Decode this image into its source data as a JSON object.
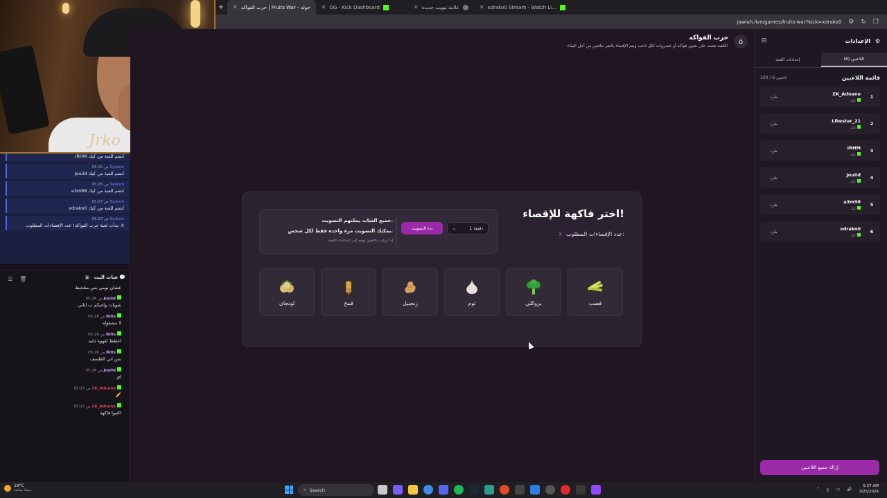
{
  "browser": {
    "tabs": [
      {
        "label": "حرب الفواكه | Fruits War - جوله",
        "active": true
      },
      {
        "label": "OG - Kick Dashboard",
        "active": false
      },
      {
        "label": "علامة تبويب جديدة",
        "active": false
      },
      {
        "label": "xdrako0 Stream - Watch Li...",
        "active": false
      }
    ],
    "url": "jawlah.live/games/fruits-war?kick=xdrako0"
  },
  "webcam": {
    "signature": "Jrko"
  },
  "system_messages": [
    {
      "user": "",
      "time": "",
      "text": "IRHM انضم للعبة من كيك"
    },
    {
      "user": "System",
      "time": "05:25 ص",
      "text": "Jouiid انضم للعبة من كيك"
    },
    {
      "user": "System",
      "time": "05:25 ص",
      "text": "a3m98 انضم للعبة من كيك"
    },
    {
      "user": "System",
      "time": "05:27 ص",
      "text": "xdrako0 انضم للعبة من كيك"
    },
    {
      "user": "System",
      "time": "05:27 ص",
      "text": "بدأت لعبة حرب الفواكه! عدد الإقصاءات المطلوب: X"
    }
  ],
  "chat": {
    "title": "شات البث",
    "first_message": "عشان تومي بس متلخبط",
    "messages": [
      {
        "user": "Jouiid",
        "time": "05:26 ص",
        "text": "شويات واجيكم ب ايابي"
      },
      {
        "user": "Bilts",
        "time": "05:26 ص",
        "text": "لا مشفوله"
      },
      {
        "user": "Bilts",
        "time": "05:26 ص",
        "text": "اخطط لقهوة ثانيه"
      },
      {
        "user": "Bilts",
        "time": "05:26 ص",
        "text": "بس اني الفلسف"
      },
      {
        "user": "Jouiid",
        "time": "05:26 ص",
        "text": "اي"
      },
      {
        "user": "ZK_Adnane",
        "time": "05:27 ص",
        "text": "🥖"
      },
      {
        "user": "ZK_Adnane",
        "time": "05:27 ص",
        "text": "اكتبوا فاكهة"
      }
    ]
  },
  "game": {
    "title": "حرب الفواكه",
    "description": "اللعبة تعتمد على تعيين فواكه أو خضروات لكل لاعب ويتم الإقصاء بالتفر تنافس من أجل البقاء!",
    "card_title": "اختر فاكهة للإقصاء!",
    "eliminations_label": "عدد الإقصاءات المطلوب:",
    "eliminations_value": "X",
    "vote_line1": "جميع الشات يمكنهم التصويت.",
    "vote_line2": "يمكنك التصويت مرة واحدة فقط لكل شخص.",
    "vote_hint": "إذا ترغب بالتغيير توجه إلى إعدادات اللعبة",
    "start_vote_label": "بدء التصويت",
    "duration_label": "1 دقيقة",
    "fruits": [
      {
        "label": "قصب",
        "icon": "sugarcane-icon",
        "color": "#c8d84a"
      },
      {
        "label": "بروكلي",
        "icon": "broccoli-icon",
        "color": "#3fae3a"
      },
      {
        "label": "ثوم",
        "icon": "garlic-icon",
        "color": "#e9e3dc"
      },
      {
        "label": "زنجبيل",
        "icon": "ginger-icon",
        "color": "#d6a25a"
      },
      {
        "label": "قمح",
        "icon": "wheat-icon",
        "color": "#d9a441"
      },
      {
        "label": "لونجان",
        "icon": "longan-icon",
        "color": "#d8c17a"
      }
    ]
  },
  "panel": {
    "title": "الإعدادات",
    "tab_players": "اللاعبين (6)",
    "tab_settings": "إعدادات اللعبة",
    "list_title": "قائمة اللاعبين",
    "count": "100 / 6 لاعبين",
    "kick_label": "طرد",
    "platform": "كيك",
    "players": [
      {
        "num": "1",
        "name": "ZK_Adnane"
      },
      {
        "num": "2",
        "name": "Likestar_21"
      },
      {
        "num": "3",
        "name": "IRHM"
      },
      {
        "num": "4",
        "name": "Jouiid"
      },
      {
        "num": "5",
        "name": "a3m98"
      },
      {
        "num": "6",
        "name": "xdrako0"
      }
    ],
    "remove_all_label": "إزالة جميع اللاعبين"
  },
  "taskbar": {
    "weather_temp": "19°C",
    "weather_desc": "سماء صافية",
    "search_label": "Search",
    "lang": "ع",
    "time": "5:27 AM",
    "date": "3/25/2026"
  }
}
